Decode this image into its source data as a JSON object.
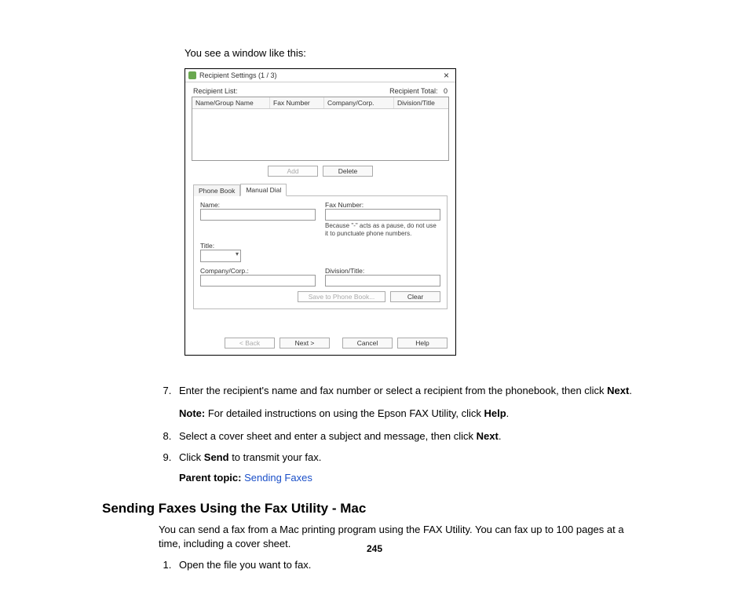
{
  "intro_text": "You see a window like this:",
  "dialog": {
    "title": "Recipient Settings (1 / 3)",
    "recipient_list_label": "Recipient List:",
    "recipient_total_label": "Recipient Total:",
    "recipient_total_value": "0",
    "columns": [
      "Name/Group Name",
      "Fax Number",
      "Company/Corp.",
      "Division/Title"
    ],
    "add_label": "Add",
    "delete_label": "Delete",
    "tab_phonebook": "Phone Book",
    "tab_manual": "Manual Dial",
    "name_label": "Name:",
    "faxnum_label": "Fax Number:",
    "faxnum_hint": "Because \"-\" acts as a pause, do not use it to punctuate phone numbers.",
    "title_label": "Title:",
    "company_label": "Company/Corp.:",
    "division_label": "Division/Title:",
    "save_label": "Save to Phone Book...",
    "clear_label": "Clear",
    "back_label": "< Back",
    "next_label": "Next >",
    "cancel_label": "Cancel",
    "help_label": "Help"
  },
  "steps": {
    "s7_a": "Enter the recipient's name and fax number or select a recipient from the phonebook, then click ",
    "s7_b": "Next",
    "s7_c": ".",
    "note_label": "Note:",
    "note_a": " For detailed instructions on using the Epson FAX Utility, click ",
    "note_b": "Help",
    "note_c": ".",
    "s8_a": "Select a cover sheet and enter a subject and message, then click ",
    "s8_b": "Next",
    "s8_c": ".",
    "s9_a": "Click ",
    "s9_b": "Send",
    "s9_c": " to transmit your fax.",
    "parent_label": "Parent topic:",
    "parent_link": "Sending Faxes"
  },
  "heading": "Sending Faxes Using the Fax Utility - Mac",
  "section_text": "You can send a fax from a Mac printing program using the FAX Utility. You can fax up to 100 pages at a time, including a cover sheet.",
  "mac_step1": "Open the file you want to fax.",
  "page_number": "245"
}
